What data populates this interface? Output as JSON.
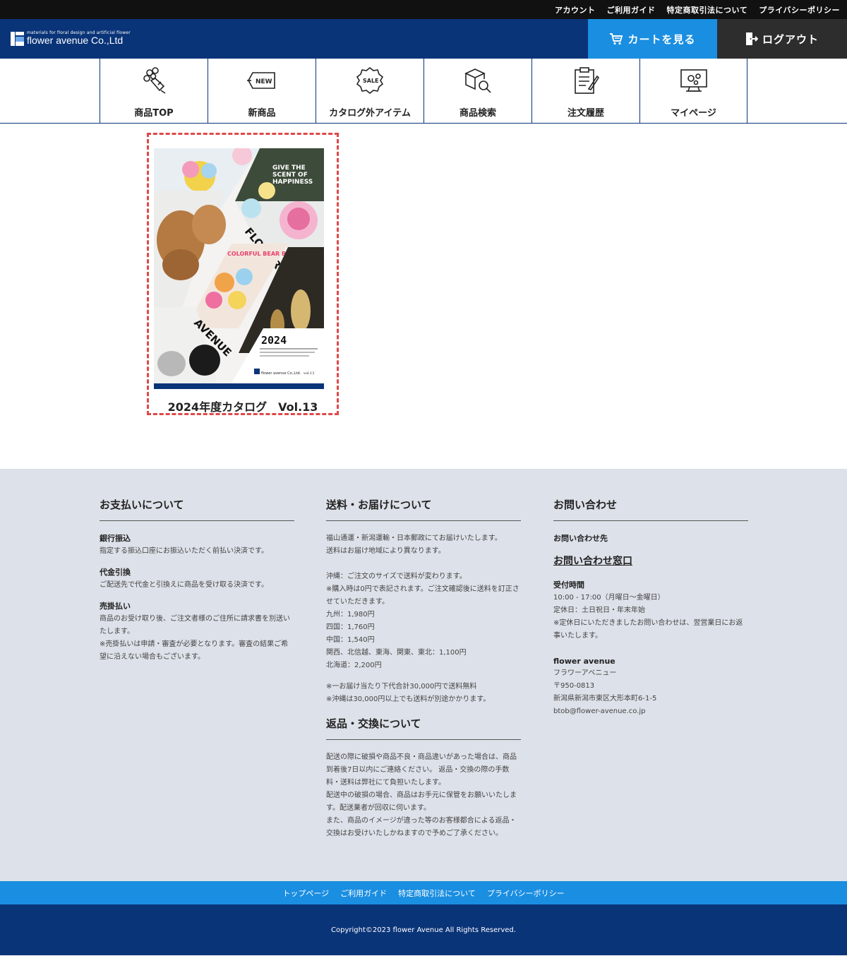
{
  "topbar": {
    "links": [
      "アカウント",
      "ご利用ガイド",
      "特定商取引法について",
      "プライバシーポリシー"
    ]
  },
  "header": {
    "logo_sub": "materials for floral design and artificial flower",
    "logo_main": "flower avenue Co.,Ltd",
    "cart_label": "カートを見る",
    "logout_label": "ログアウト"
  },
  "nav": {
    "items": [
      {
        "label": "商品TOP",
        "icon": "bouquet-icon"
      },
      {
        "label": "新商品",
        "icon": "new-tag-icon"
      },
      {
        "label": "カタログ外アイテム",
        "icon": "sale-badge-icon"
      },
      {
        "label": "商品検索",
        "icon": "box-search-icon"
      },
      {
        "label": "注文履歴",
        "icon": "clipboard-icon"
      },
      {
        "label": "マイページ",
        "icon": "monitor-gear-icon"
      }
    ]
  },
  "catalog": {
    "title": "2024年度カタログ　Vol.13",
    "cover": {
      "headline": "GIVE THE SCENT OF HAPPINESS",
      "word1": "FLOWER",
      "word2": "AVENUE",
      "bear_text": "COLORFUL BEAR BOU",
      "year": "2024",
      "brand": "flower avenue Co.,Ltd.",
      "vol": "vol.13"
    }
  },
  "footer": {
    "payment": {
      "title": "お支払いについて",
      "items": [
        {
          "name": "銀行振込",
          "desc": "指定する振込口座にお振込いただく前払い決済です。"
        },
        {
          "name": "代金引換",
          "desc": "ご配送先で代金と引換えに商品を受け取る決済です。"
        },
        {
          "name": "売掛払い",
          "desc": "商品のお受け取り後、ご注文者様のご住所に請求書を別送いたします。\n※売掛払いは申請・審査が必要となります。審査の結果ご希望に沿えない場合もございます。"
        }
      ]
    },
    "shipping": {
      "title": "送料・お届けについて",
      "p1": "福山通運・新潟運輸・日本郵政にてお届けいたします。\n送料はお届け地域により異なります。",
      "p2": "沖縄：ご注文のサイズで送料が変わります。\n※購入時は0円で表記されます。ご注文確認後に送料を訂正させていただきます。\n九州：1,980円\n四国：1,760円\n中国：1,540円\n関西、北信越、東海、関東、東北：1,100円\n北海道：2,200円",
      "p3": "※一お届け当たり下代合計30,000円で送料無料\n※沖縄は30,000円以上でも送料が別途かかります。"
    },
    "returns": {
      "title": "返品・交換について",
      "text": "配送の際に破損や商品不良・商品違いがあった場合は、商品到着後7日以内にご連絡ください。 返品・交換の際の手数料・送料は弊社にて負担いたします。\n配送中の破損の場合、商品はお手元に保管をお願いいたします。配送業者が回収に伺います。\nまた、商品のイメージが違った等のお客様都合による返品・交換はお受けいたしかねますので予めご了承ください。"
    },
    "contact": {
      "title": "お問い合わせ",
      "dest_label": "お問い合わせ先",
      "link_label": "お問い合わせ窓口",
      "hours_label": "受付時間",
      "hours_text": "10:00 - 17:00（月曜日～金曜日）\n定休日：土日祝日・年末年始\n※定休日にいただきましたお問い合わせは、翌営業日にお返事いたします。",
      "company_name": "flower avenue",
      "company_text": "フラワーアベニュー\n〒950-0813\n新潟県新潟市東区大形本町6-1-5\nbtob@flower-avenue.co.jp"
    }
  },
  "bottom_links": [
    "トップページ",
    "ご利用ガイド",
    "特定商取引法について",
    "プライバシーポリシー"
  ],
  "copyright": "Copyright©2023 flower Avenue All Rights Reserved.",
  "colors": {
    "navy": "#0a3478",
    "blue": "#1a8ee1",
    "dark": "#2d2d2d",
    "footer_bg": "#dde1e9",
    "dash": "#e04848"
  }
}
